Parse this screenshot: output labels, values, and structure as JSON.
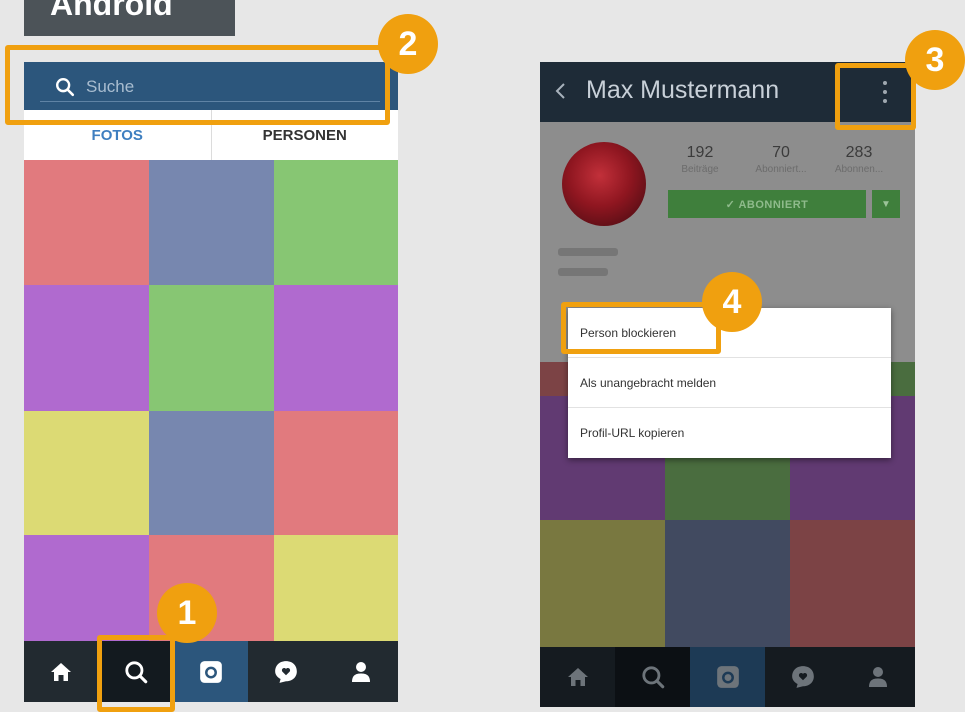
{
  "platform_label": "Android",
  "colors": {
    "accent_orange": "#f0a00f",
    "header_blue": "#2c567c",
    "navbar_dark": "#222a30",
    "red": "#e17a7e",
    "blue": "#7787af",
    "green": "#87c673",
    "purple": "#b06acf",
    "yellow": "#dcda74"
  },
  "phone_search": {
    "search_placeholder": "Suche",
    "tabs": [
      {
        "label": "FOTOS",
        "active": true
      },
      {
        "label": "PERSONEN",
        "active": false
      }
    ],
    "grid_colors": [
      "red",
      "blue",
      "green",
      "purple",
      "green",
      "purple",
      "yellow",
      "blue",
      "red",
      "purple",
      "red",
      "yellow"
    ],
    "navbar": [
      "home-icon",
      "search-icon",
      "camera-icon",
      "heart-bubble-icon",
      "profile-icon"
    ]
  },
  "phone_profile": {
    "username": "Max Mustermann",
    "stats": [
      {
        "value": "192",
        "label": "Beiträge"
      },
      {
        "value": "70",
        "label": "Abonniert..."
      },
      {
        "value": "283",
        "label": "Abonnen..."
      }
    ],
    "follow_label": "✓ ABONNIERT",
    "menu": {
      "items": [
        "Person blockieren",
        "Als unangebracht melden",
        "Profil-URL kopieren"
      ]
    },
    "grid_colors": [
      "red",
      "green",
      "green",
      "purple",
      "green",
      "purple",
      "yellow",
      "blue",
      "red"
    ],
    "navbar": [
      "home-icon",
      "search-icon",
      "camera-icon",
      "heart-bubble-icon",
      "profile-icon"
    ]
  },
  "markers": [
    "1",
    "2",
    "3",
    "4"
  ]
}
